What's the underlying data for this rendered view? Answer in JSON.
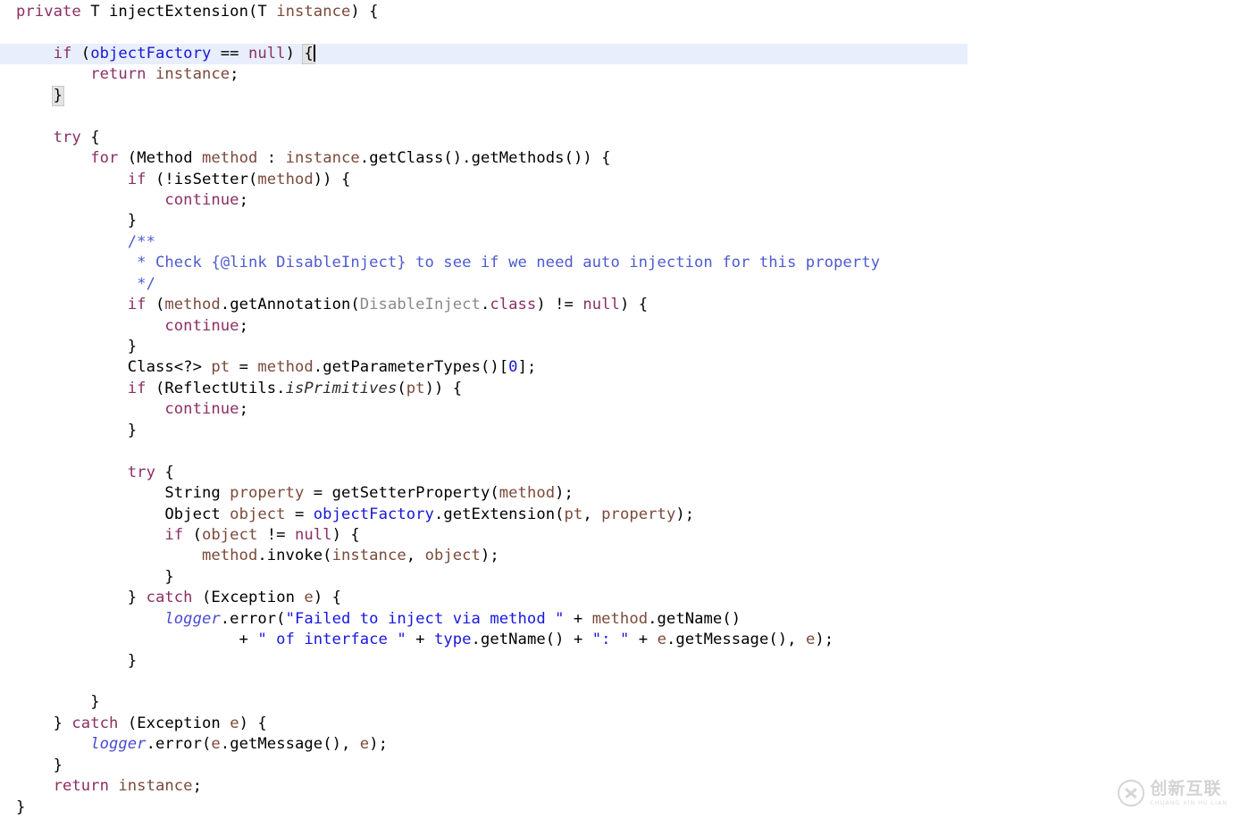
{
  "editor": {
    "language": "java",
    "current_line_number": 2,
    "caret_after_text": "if (objectFactory == null) {",
    "highlight_color": "#e8eefc",
    "background_color": "#ffffff"
  },
  "colors": {
    "keyword": "#8c2f63",
    "field": "#1717d6",
    "local_variable": "#7a4a3a",
    "string_literal": "#1717e0",
    "javadoc_comment": "#4f5bd0",
    "unresolved_class": "#8a8a8a",
    "plain_text": "#000000"
  },
  "code": {
    "lines": [
      "private T injectExtension(T instance) {",
      "",
      "    if (objectFactory == null) {",
      "        return instance;",
      "    }",
      "",
      "    try {",
      "        for (Method method : instance.getClass().getMethods()) {",
      "            if (!isSetter(method)) {",
      "                continue;",
      "            }",
      "            /**",
      "             * Check {@link DisableInject} to see if we need auto injection for this property",
      "             */",
      "            if (method.getAnnotation(DisableInject.class) != null) {",
      "                continue;",
      "            }",
      "            Class<?> pt = method.getParameterTypes()[0];",
      "            if (ReflectUtils.isPrimitives(pt)) {",
      "                continue;",
      "            }",
      "",
      "            try {",
      "                String property = getSetterProperty(method);",
      "                Object object = objectFactory.getExtension(pt, property);",
      "                if (object != null) {",
      "                    method.invoke(instance, object);",
      "                }",
      "            } catch (Exception e) {",
      "                logger.error(\"Failed to inject via method \" + method.getName()",
      "                        + \" of interface \" + type.getName() + \": \" + e.getMessage(), e);",
      "            }",
      "",
      "        }",
      "    } catch (Exception e) {",
      "        logger.error(e.getMessage(), e);",
      "    }",
      "    return instance;",
      "}"
    ]
  },
  "watermark": {
    "icon": "circled-x-logo",
    "chinese_text": "创新互联",
    "pinyin_text": "CHUANG XIN HU LIAN"
  }
}
